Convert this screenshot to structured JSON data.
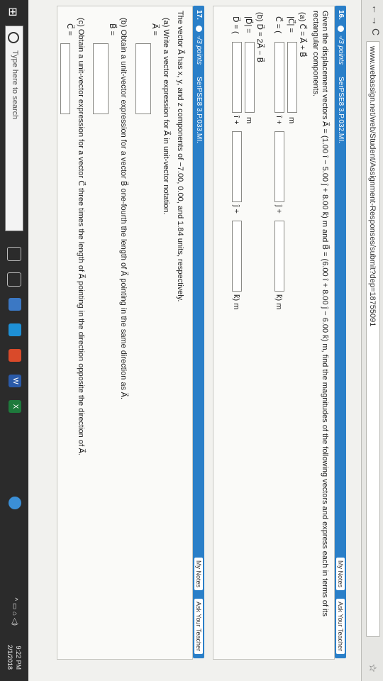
{
  "browser": {
    "url": "www.webassign.net/web/Student/Assignment-Responses/submit?dep=18755091",
    "back": "←",
    "forward": "→",
    "reload": "C",
    "star": "☆"
  },
  "q16": {
    "number": "16.",
    "points": "-/3 points",
    "code": "SerPSE8 3.P.032.MI.",
    "my_notes": "My Notes",
    "ask": "Ask Your Teacher",
    "intro": "Given the displacement vectors A⃗ = (1.00 î − 5.00 ĵ + 8.00 k̂) m and B⃗ = (6.00 î + 8.00 ĵ − 6.00 k̂) m, find the magnitudes of the following vectors and express each in terms of its",
    "intro2": "rectangular components.",
    "a_label": "(a) C⃗ = A⃗ + B⃗",
    "c_mag": "|C⃗| =",
    "c_vec": "C⃗ = (",
    "b_label": "(b) D⃗ = 2A⃗ − B⃗",
    "d_mag": "|D⃗| =",
    "d_vec": "D⃗ = (",
    "unit_m": "m",
    "i_plus": "î +",
    "j_plus": "ĵ +",
    "k_m": "k̂) m"
  },
  "q17": {
    "number": "17.",
    "points": "-/3 points",
    "code": "SerPSE8 3.P.033.MI.",
    "my_notes": "My Notes",
    "ask": "Ask Your Teacher",
    "intro": "The vector A⃗ has x, y, and z components of −7.00, 0.00, and 1.84 units, respectively.",
    "a_text": "(a) Write a vector expression for A⃗ in unit-vector notation.",
    "a_eq": "A⃗ =",
    "b_text": "(b) Obtain a unit-vector expression for a vector B⃗ one-fourth the length of A⃗ pointing in the same direction as A⃗.",
    "b_eq": "B⃗ =",
    "c_text": "(c) Obtain a unit-vector expression for a vector C⃗ three times the length of A⃗ pointing in the direction opposite the direction of A⃗.",
    "c_eq": "C⃗ ="
  },
  "taskbar": {
    "search_placeholder": "Type here to search",
    "time": "9:22 PM",
    "date": "2/1/2018",
    "tray": "^ ▭ ⌂ ◁)"
  },
  "colors": {
    "accent": "#2a7fc8",
    "taskbar": "#2b2b2b"
  }
}
